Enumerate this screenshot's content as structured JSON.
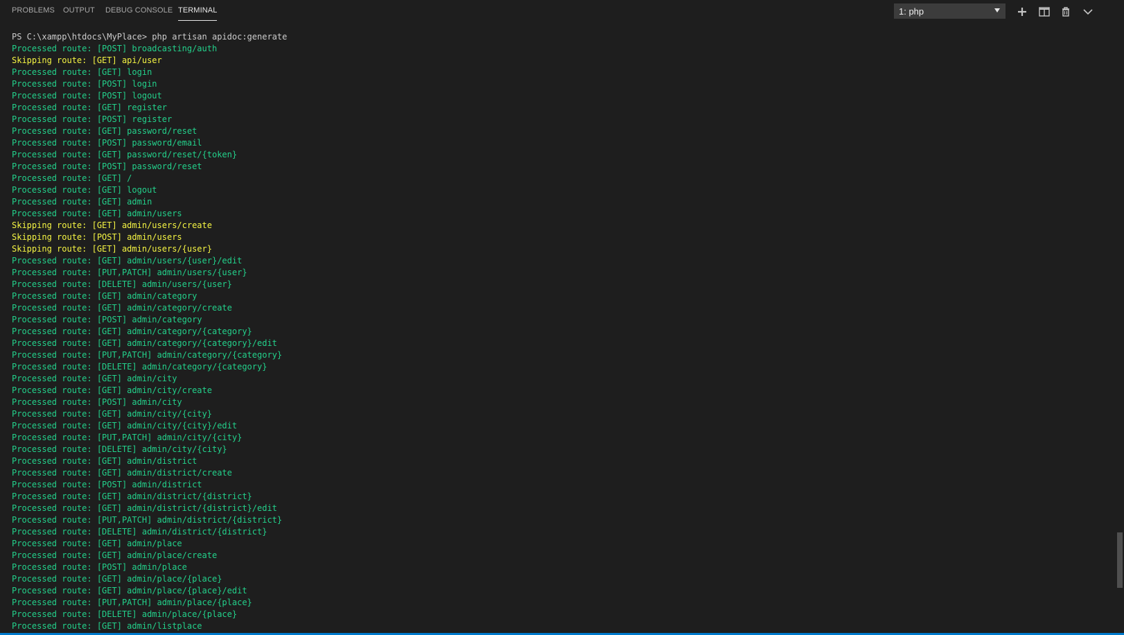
{
  "tabs": [
    {
      "label": "PROBLEMS"
    },
    {
      "label": "OUTPUT"
    },
    {
      "label": "DEBUG CONSOLE"
    },
    {
      "label": "TERMINAL"
    }
  ],
  "active_tab": "TERMINAL",
  "terminal_selector": {
    "value": "1: php"
  },
  "actions": [
    {
      "icon": "plus-icon"
    },
    {
      "icon": "split-terminal-icon"
    },
    {
      "icon": "trash-icon"
    },
    {
      "icon": "chevron-down-icon"
    }
  ],
  "colors": {
    "background": "#1e1e1e",
    "processed": "#23d18b",
    "skipped": "#f5f543",
    "command": "#cccccc",
    "accent": "#007acc"
  },
  "terminal": {
    "lines": [
      {
        "type": "cmd",
        "text": "PS C:\\xampp\\htdocs\\MyPlace> php artisan apidoc:generate"
      },
      {
        "type": "processed",
        "text": "Processed route: [POST] broadcasting/auth"
      },
      {
        "type": "skipped",
        "text": "Skipping route: [GET] api/user"
      },
      {
        "type": "processed",
        "text": "Processed route: [GET] login"
      },
      {
        "type": "processed",
        "text": "Processed route: [POST] login"
      },
      {
        "type": "processed",
        "text": "Processed route: [POST] logout"
      },
      {
        "type": "processed",
        "text": "Processed route: [GET] register"
      },
      {
        "type": "processed",
        "text": "Processed route: [POST] register"
      },
      {
        "type": "processed",
        "text": "Processed route: [GET] password/reset"
      },
      {
        "type": "processed",
        "text": "Processed route: [POST] password/email"
      },
      {
        "type": "processed",
        "text": "Processed route: [GET] password/reset/{token}"
      },
      {
        "type": "processed",
        "text": "Processed route: [POST] password/reset"
      },
      {
        "type": "processed",
        "text": "Processed route: [GET] /"
      },
      {
        "type": "processed",
        "text": "Processed route: [GET] logout"
      },
      {
        "type": "processed",
        "text": "Processed route: [GET] admin"
      },
      {
        "type": "processed",
        "text": "Processed route: [GET] admin/users"
      },
      {
        "type": "skipped",
        "text": "Skipping route: [GET] admin/users/create"
      },
      {
        "type": "skipped",
        "text": "Skipping route: [POST] admin/users"
      },
      {
        "type": "skipped",
        "text": "Skipping route: [GET] admin/users/{user}"
      },
      {
        "type": "processed",
        "text": "Processed route: [GET] admin/users/{user}/edit"
      },
      {
        "type": "processed",
        "text": "Processed route: [PUT,PATCH] admin/users/{user}"
      },
      {
        "type": "processed",
        "text": "Processed route: [DELETE] admin/users/{user}"
      },
      {
        "type": "processed",
        "text": "Processed route: [GET] admin/category"
      },
      {
        "type": "processed",
        "text": "Processed route: [GET] admin/category/create"
      },
      {
        "type": "processed",
        "text": "Processed route: [POST] admin/category"
      },
      {
        "type": "processed",
        "text": "Processed route: [GET] admin/category/{category}"
      },
      {
        "type": "processed",
        "text": "Processed route: [GET] admin/category/{category}/edit"
      },
      {
        "type": "processed",
        "text": "Processed route: [PUT,PATCH] admin/category/{category}"
      },
      {
        "type": "processed",
        "text": "Processed route: [DELETE] admin/category/{category}"
      },
      {
        "type": "processed",
        "text": "Processed route: [GET] admin/city"
      },
      {
        "type": "processed",
        "text": "Processed route: [GET] admin/city/create"
      },
      {
        "type": "processed",
        "text": "Processed route: [POST] admin/city"
      },
      {
        "type": "processed",
        "text": "Processed route: [GET] admin/city/{city}"
      },
      {
        "type": "processed",
        "text": "Processed route: [GET] admin/city/{city}/edit"
      },
      {
        "type": "processed",
        "text": "Processed route: [PUT,PATCH] admin/city/{city}"
      },
      {
        "type": "processed",
        "text": "Processed route: [DELETE] admin/city/{city}"
      },
      {
        "type": "processed",
        "text": "Processed route: [GET] admin/district"
      },
      {
        "type": "processed",
        "text": "Processed route: [GET] admin/district/create"
      },
      {
        "type": "processed",
        "text": "Processed route: [POST] admin/district"
      },
      {
        "type": "processed",
        "text": "Processed route: [GET] admin/district/{district}"
      },
      {
        "type": "processed",
        "text": "Processed route: [GET] admin/district/{district}/edit"
      },
      {
        "type": "processed",
        "text": "Processed route: [PUT,PATCH] admin/district/{district}"
      },
      {
        "type": "processed",
        "text": "Processed route: [DELETE] admin/district/{district}"
      },
      {
        "type": "processed",
        "text": "Processed route: [GET] admin/place"
      },
      {
        "type": "processed",
        "text": "Processed route: [GET] admin/place/create"
      },
      {
        "type": "processed",
        "text": "Processed route: [POST] admin/place"
      },
      {
        "type": "processed",
        "text": "Processed route: [GET] admin/place/{place}"
      },
      {
        "type": "processed",
        "text": "Processed route: [GET] admin/place/{place}/edit"
      },
      {
        "type": "processed",
        "text": "Processed route: [PUT,PATCH] admin/place/{place}"
      },
      {
        "type": "processed",
        "text": "Processed route: [DELETE] admin/place/{place}"
      },
      {
        "type": "processed",
        "text": "Processed route: [GET] admin/listplace"
      }
    ]
  }
}
